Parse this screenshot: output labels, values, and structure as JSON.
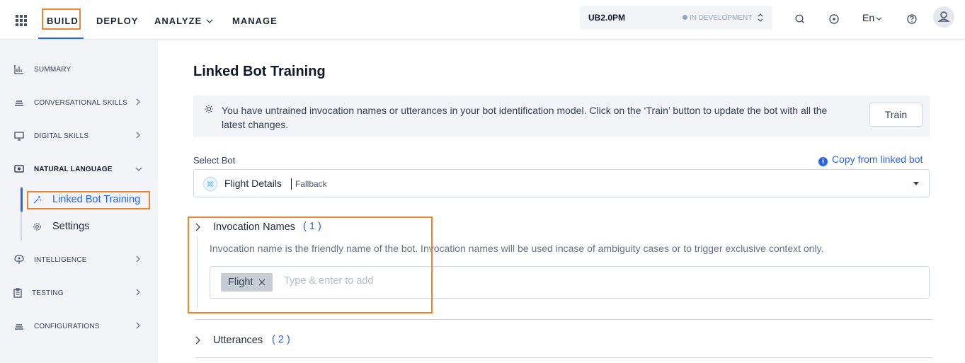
{
  "topbar": {
    "nav": [
      "BUILD",
      "DEPLOY",
      "ANALYZE",
      "MANAGE"
    ],
    "bot_name": "UB2.0PM",
    "bot_status": "IN DEVELOPMENT",
    "language": "En",
    "icons": [
      "apps-grid-icon",
      "search-icon",
      "compass-icon",
      "help-icon",
      "user-icon"
    ],
    "accent_color": "#2563eb",
    "highlight_color": "#f0832d"
  },
  "sidebar": {
    "items": [
      {
        "label": "SUMMARY",
        "icon": "bar-chart-icon"
      },
      {
        "label": "CONVERSATIONAL SKILLS",
        "icon": "layers-icon"
      },
      {
        "label": "DIGITAL SKILLS",
        "icon": "monitor-icon"
      },
      {
        "label": "NATURAL LANGUAGE",
        "icon": "nl-chat-icon"
      },
      {
        "label": "INTELLIGENCE",
        "icon": "brain-icon"
      },
      {
        "label": "TESTING",
        "icon": "clipboard-icon"
      },
      {
        "label": "CONFIGURATIONS",
        "icon": "layers-icon"
      }
    ],
    "sub_items": [
      {
        "label": "Linked Bot Training",
        "icon": "magic-wand-icon"
      },
      {
        "label": "Settings",
        "icon": "gear-icon"
      }
    ]
  },
  "main": {
    "title": "Linked Bot Training",
    "banner_text": "You have untrained invocation names or utterances in your bot identification model. Click on the ‘Train’ button to update the bot with all the latest changes.",
    "train_label": "Train",
    "select_label": "Select Bot",
    "copy_link": "Copy from linked bot",
    "selected_bot": "Flight Details",
    "selected_bot_type": "Fallback",
    "invocation": {
      "label": "Invocation Names",
      "count": "( 1 )",
      "description": "Invocation name is the friendly name of the bot. Invocation names will be used incase of ambiguity cases or to trigger exclusive context only.",
      "tags": [
        "Flight"
      ],
      "placeholder": "Type & enter to add"
    },
    "utterances": {
      "label": "Utterances",
      "count": "( 2 )"
    }
  }
}
